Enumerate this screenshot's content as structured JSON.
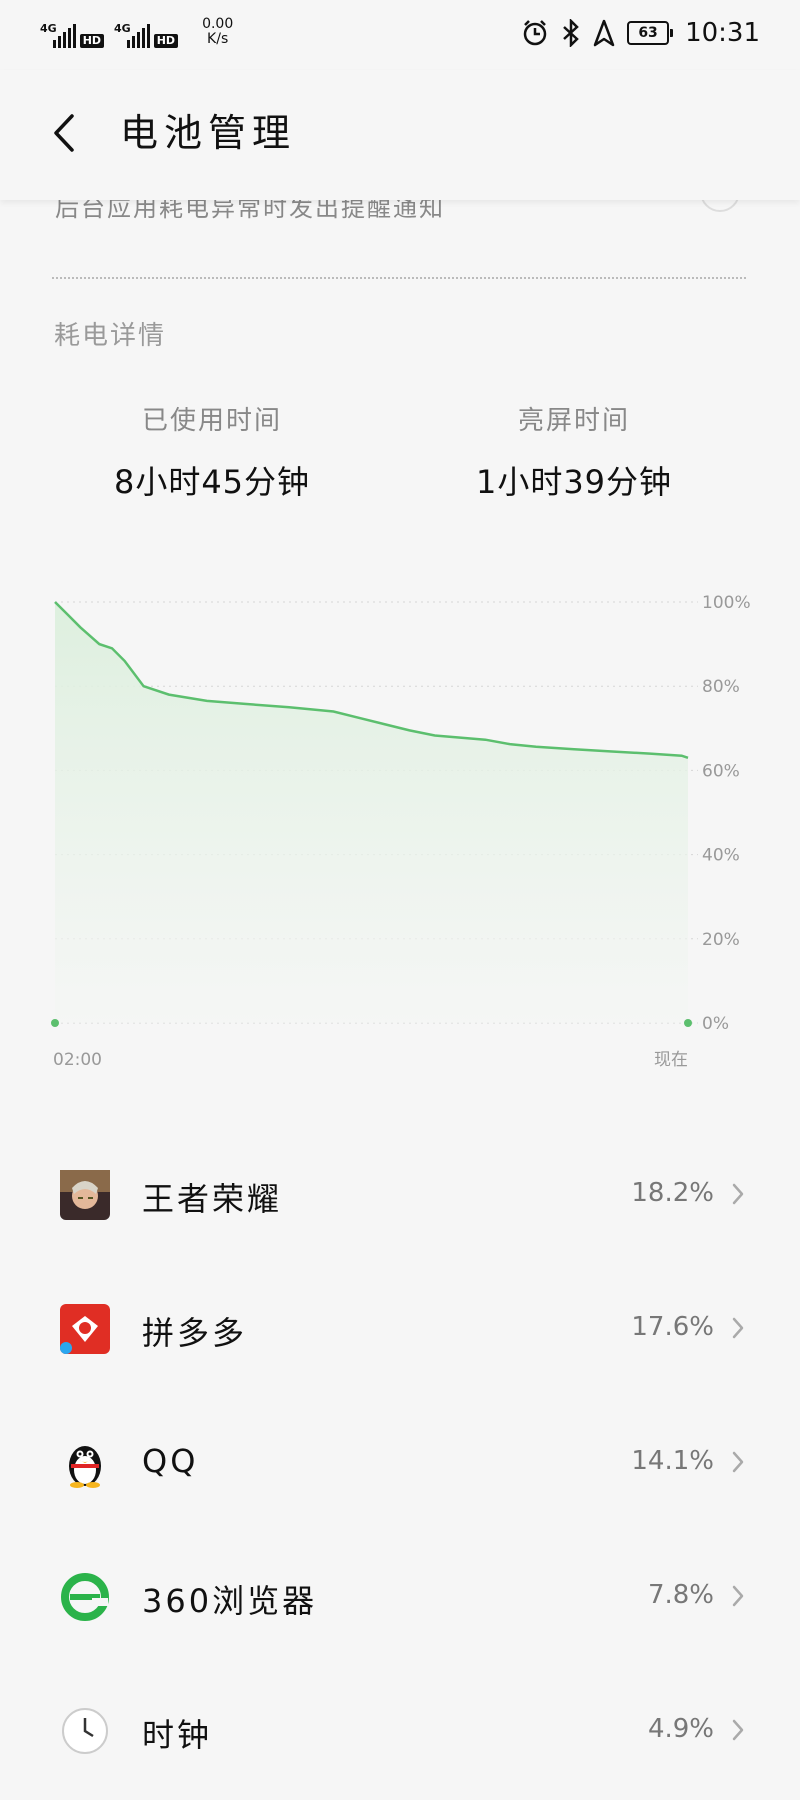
{
  "status": {
    "net1": "4G",
    "net2": "4G",
    "hd": "HD",
    "speed_value": "0.00",
    "speed_unit": "K/s",
    "battery": "63",
    "time": "10:31"
  },
  "header": {
    "title": "电池管理"
  },
  "notice": {
    "partial_text": "后台应用耗电异常时发出提醒通知"
  },
  "usage": {
    "section_label": "耗电详情",
    "used_label": "已使用时间",
    "used_value": "8小时45分钟",
    "screen_label": "亮屏时间",
    "screen_value": "1小时39分钟"
  },
  "chart_data": {
    "type": "area",
    "x_start_label": "02:00",
    "x_end_label": "现在",
    "y_ticks": [
      "100%",
      "80%",
      "60%",
      "40%",
      "20%",
      "0%"
    ],
    "ylim": [
      0,
      100
    ],
    "series": [
      {
        "x": [
          0,
          0.02,
          0.04,
          0.07,
          0.09,
          0.11,
          0.14,
          0.18,
          0.24,
          0.3,
          0.37,
          0.44,
          0.48,
          0.52,
          0.56,
          0.6,
          0.64,
          0.68,
          0.72,
          0.76,
          0.82,
          0.88,
          0.94,
          0.99,
          1.0
        ],
        "values": [
          100,
          97,
          94,
          90,
          89,
          86,
          80,
          78,
          76.5,
          75.8,
          75,
          74,
          72.5,
          71,
          69.5,
          68.3,
          67.8,
          67.3,
          66.2,
          65.6,
          65,
          64.5,
          64,
          63.5,
          63
        ]
      }
    ],
    "line_color": "#5cbf6e",
    "fill_color": "#d8eed9",
    "grid": true
  },
  "apps": [
    {
      "name": "王者荣耀",
      "percent": "18.2%",
      "icon": "honor-of-kings-icon"
    },
    {
      "name": "拼多多",
      "percent": "17.6%",
      "icon": "pinduoduo-icon"
    },
    {
      "name": "QQ",
      "percent": "14.1%",
      "icon": "qq-penguin-icon"
    },
    {
      "name": "360浏览器",
      "percent": "7.8%",
      "icon": "360-browser-icon"
    },
    {
      "name": "时钟",
      "percent": "4.9%",
      "icon": "clock-icon"
    }
  ]
}
